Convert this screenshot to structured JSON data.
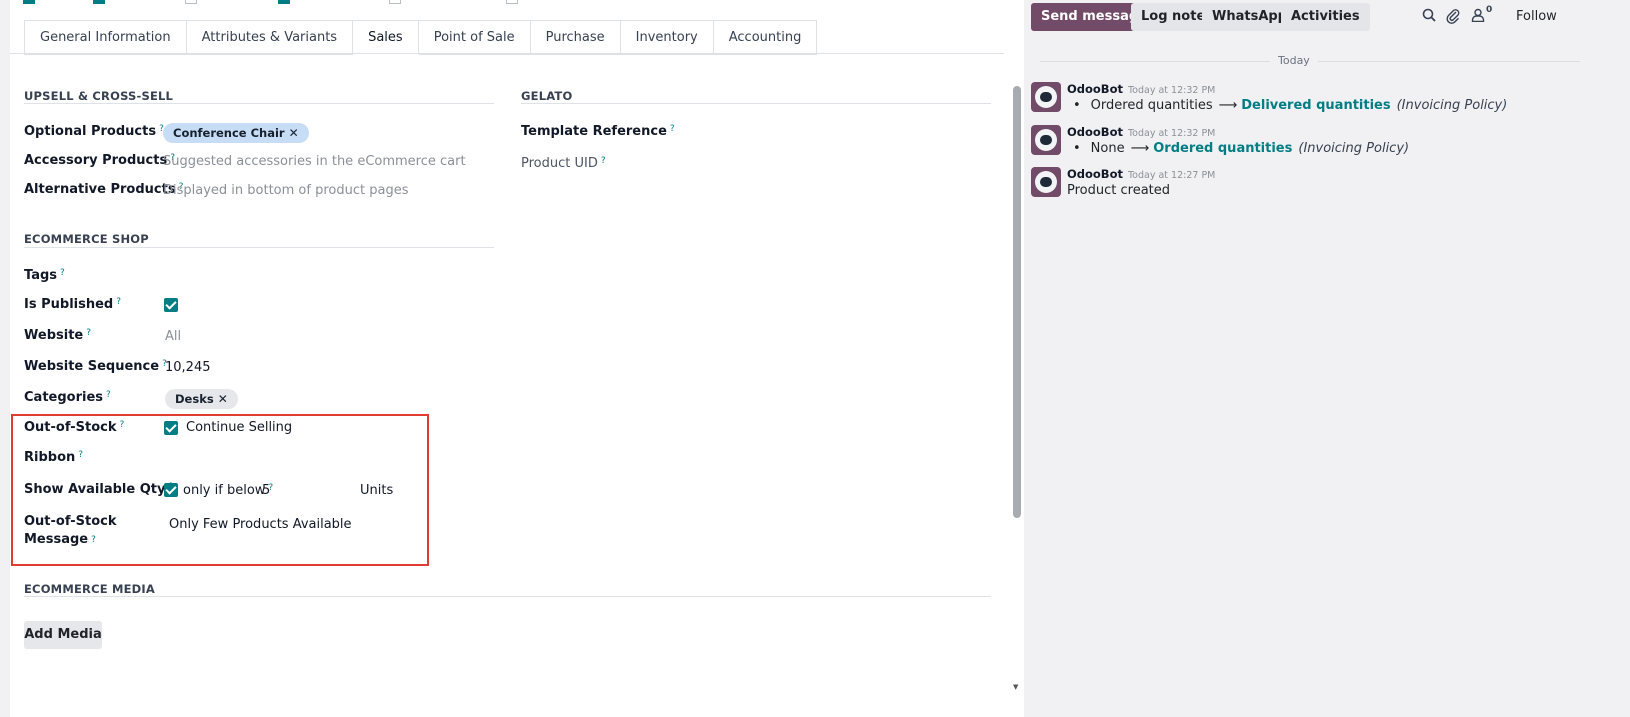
{
  "tabs": [
    "General Information",
    "Attributes & Variants",
    "Sales",
    "Point of Sale",
    "Purchase",
    "Inventory",
    "Accounting"
  ],
  "active_tab": "Sales",
  "upsell": {
    "title": "UPSELL & CROSS-SELL",
    "optional_label": "Optional Products",
    "optional_tag": "Conference Chair",
    "accessory_label": "Accessory Products",
    "accessory_placeholder": "Suggested accessories in the eCommerce cart",
    "alternative_label": "Alternative Products",
    "alternative_placeholder": "Displayed in bottom of product pages"
  },
  "gelato": {
    "title": "GELATO",
    "template_label": "Template Reference",
    "uid_label": "Product UID"
  },
  "ecommerce": {
    "title": "ECOMMERCE SHOP",
    "tags_label": "Tags",
    "published_label": "Is Published",
    "website_label": "Website",
    "website_value": "All",
    "sequence_label": "Website Sequence",
    "sequence_value": "10,245",
    "categories_label": "Categories",
    "category_tag": "Desks",
    "oos_label": "Out-of-Stock",
    "oos_value": "Continue Selling",
    "ribbon_label": "Ribbon",
    "show_qty_label": "Show Available Qty",
    "only_if_below": "only if below",
    "threshold": "5",
    "units": "Units",
    "oos_msg_label_1": "Out-of-Stock",
    "oos_msg_label_2": "Message",
    "oos_msg_value": "Only Few Products Available"
  },
  "media": {
    "title": "ECOMMERCE MEDIA",
    "add_button": "Add Media"
  },
  "help_mark": "?",
  "remove_mark": "✕",
  "chatter": {
    "send_message": "Send message",
    "log_note": "Log note",
    "whatsapp": "WhatsApp",
    "activities": "Activities",
    "followers_count": "0",
    "follow": "Follow",
    "today": "Today",
    "messages": [
      {
        "author": "OdooBot",
        "time": "Today at 12:32 PM",
        "old": "Ordered quantities",
        "new": "Delivered quantities",
        "field": "(Invoicing Policy)"
      },
      {
        "author": "OdooBot",
        "time": "Today at 12:32 PM",
        "old": "None",
        "new": "Ordered quantities",
        "field": "(Invoicing Policy)"
      },
      {
        "author": "OdooBot",
        "time": "Today at 12:27 PM",
        "text": "Product created"
      }
    ]
  },
  "icons": [
    "search-icon",
    "paperclip-icon",
    "user-icon"
  ],
  "colors": {
    "accent": "#017e84",
    "primary": "#714b67",
    "highlight": "#e03c31"
  }
}
